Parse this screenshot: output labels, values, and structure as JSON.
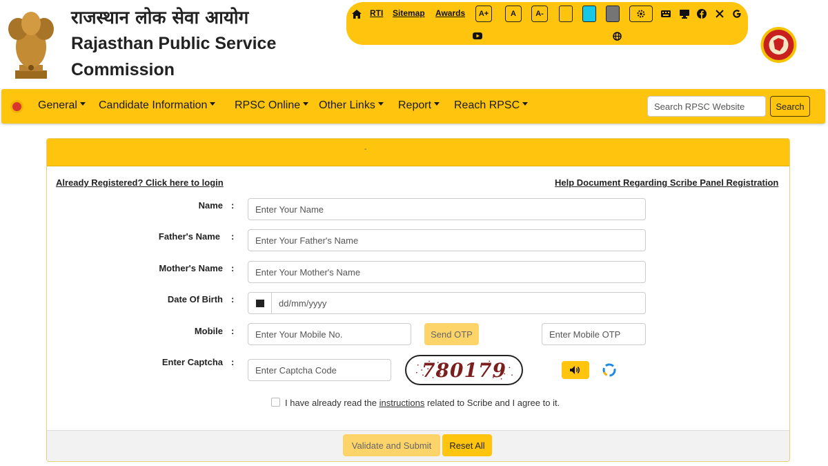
{
  "header": {
    "title_hindi": "राजस्थान लोक सेवा आयोग",
    "title_english": "Rajasthan Public Service Commission"
  },
  "topbar": {
    "links": [
      "RTI",
      "Sitemap",
      "Awards"
    ],
    "font_sizes": [
      "A+",
      "A",
      "A-"
    ],
    "theme_colors": [
      "#fec40e",
      "#18c6e6",
      "#757575"
    ],
    "icons": [
      "home-icon",
      "gear-icon",
      "keyboard-icon",
      "desktop-icon",
      "facebook-icon",
      "x-icon",
      "google-icon",
      "youtube-icon",
      "globe-icon"
    ]
  },
  "nav": {
    "items": [
      "General",
      "Candidate Information",
      "RPSC Online",
      "Other Links",
      "Report",
      "Reach RPSC"
    ],
    "search_placeholder": "Search RPSC Website",
    "search_button": "Search"
  },
  "form": {
    "header_text": "-",
    "login_link": "Already Registered? Click here to login",
    "help_link": "Help Document Regarding Scribe Panel Registration",
    "fields": {
      "name": {
        "label": "Name",
        "placeholder": "Enter Your Name"
      },
      "father": {
        "label": "Father's Name",
        "placeholder": "Enter Your Father's Name"
      },
      "mother": {
        "label": "Mother's Name",
        "placeholder": "Enter Your Mother's Name"
      },
      "dob": {
        "label": "Date Of Birth",
        "placeholder": "dd/mm/yyyy"
      },
      "mobile": {
        "label": "Mobile",
        "placeholder": "Enter Your Mobile No.",
        "otp_placeholder": "Enter Mobile OTP",
        "send_otp": "Send OTP"
      },
      "captcha": {
        "label": "Enter Captcha",
        "placeholder": "Enter Captcha Code",
        "code": "780179"
      }
    },
    "colon": ":",
    "agree_before": "I have already read the ",
    "agree_link": "instructions",
    "agree_after": " related to Scribe and I agree to it.",
    "submit": "Validate and Submit",
    "reset": "Reset All"
  },
  "colors": {
    "accent": "#fec40e",
    "accent_disabled": "#fdd46a"
  }
}
